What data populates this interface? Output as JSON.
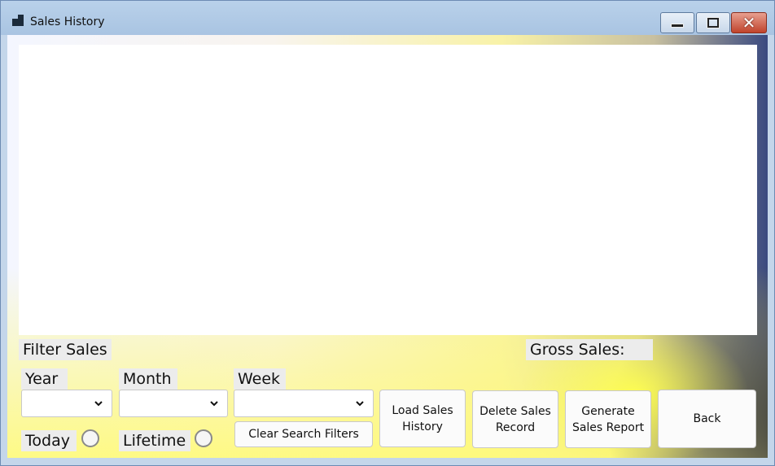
{
  "window": {
    "title": "Sales History",
    "icons": {
      "app": "app-window-icon",
      "minimize": "minimize-icon",
      "maximize": "maximize-icon",
      "close": "close-icon"
    },
    "close_glyph": "✕"
  },
  "filters": {
    "section_label": "Filter Sales",
    "year_label": "Year",
    "month_label": "Month",
    "week_label": "Week",
    "today_label": "Today",
    "lifetime_label": "Lifetime",
    "year_value": "",
    "month_value": "",
    "week_value": ""
  },
  "gross_sales_label": "Gross Sales:",
  "buttons": {
    "clear_filters": "Clear Search Filters",
    "load_history": "Load Sales\nHistory",
    "delete_record": "Delete Sales\nRecord",
    "generate_report": "Generate\nSales Report",
    "back": "Back"
  },
  "colors": {
    "accent_yellow": "#fff85a",
    "titlebar": "#b3cbe6",
    "close_button": "#c8503a"
  }
}
